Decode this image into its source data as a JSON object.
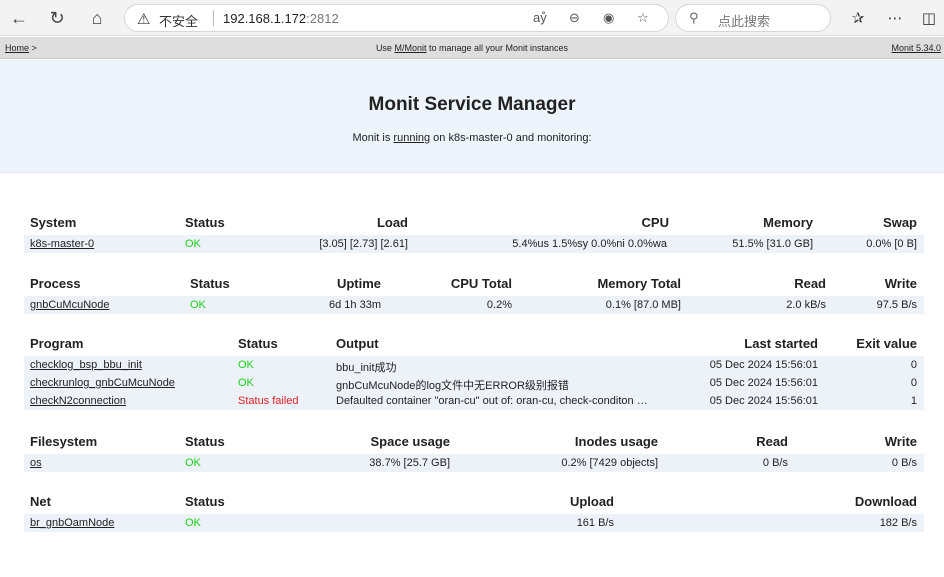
{
  "browser": {
    "insecure_label": "不安全",
    "url_host": "192.168.1.172",
    "url_port": ":2812",
    "search_placeholder": "点此搜索"
  },
  "nav": {
    "home": "Home",
    "home_sep": " >",
    "mid_prefix": "Use ",
    "mid_link": "M/Monit",
    "mid_suffix": " to manage all your Monit instances",
    "version": "Monit 5.34.0"
  },
  "header": {
    "title": "Monit Service Manager",
    "sub_prefix": "Monit is ",
    "sub_link": "running",
    "sub_suffix": " on k8s-master-0 and monitoring:"
  },
  "system": {
    "headers": {
      "name": "System",
      "status": "Status",
      "load": "Load",
      "cpu": "CPU",
      "memory": "Memory",
      "swap": "Swap"
    },
    "row": {
      "name": "k8s-master-0",
      "status": "OK",
      "load": "[3.05] [2.73] [2.61]",
      "cpu": "5.4%us 1.5%sy 0.0%ni 0.0%wa",
      "memory": "51.5% [31.0 GB]",
      "swap": "0.0% [0 B]"
    }
  },
  "process": {
    "headers": {
      "name": "Process",
      "status": "Status",
      "uptime": "Uptime",
      "cpu": "CPU Total",
      "memory": "Memory Total",
      "read": "Read",
      "write": "Write"
    },
    "row": {
      "name": "gnbCuMcuNode",
      "status": "OK",
      "uptime": "6d 1h 33m",
      "cpu": "0.2%",
      "memory": "0.1% [87.0 MB]",
      "read": "2.0 kB/s",
      "write": "97.5 B/s"
    }
  },
  "program": {
    "headers": {
      "name": "Program",
      "status": "Status",
      "output": "Output",
      "last": "Last started",
      "exit": "Exit value"
    },
    "rows": [
      {
        "name": "checklog_bsp_bbu_init",
        "status": "OK",
        "output": "bbu_init成功",
        "last": "05 Dec 2024 15:56:01",
        "exit": "0"
      },
      {
        "name": "checkrunlog_gnbCuMcuNode",
        "status": "OK",
        "output": "gnbCuMcuNode的log文件中无ERROR级别报错",
        "last": "05 Dec 2024 15:56:01",
        "exit": "0"
      },
      {
        "name": "checkN2connection",
        "status": "Status failed",
        "output": "Defaulted container \"oran-cu\" out of: oran-cu, check-conditon …",
        "last": "05 Dec 2024 15:56:01",
        "exit": "1"
      }
    ]
  },
  "filesystem": {
    "headers": {
      "name": "Filesystem",
      "status": "Status",
      "space": "Space usage",
      "inodes": "Inodes usage",
      "read": "Read",
      "write": "Write"
    },
    "row": {
      "name": "os",
      "status": "OK",
      "space": "38.7% [25.7 GB]",
      "inodes": "0.2% [7429 objects]",
      "read": "0 B/s",
      "write": "0 B/s"
    }
  },
  "net": {
    "headers": {
      "name": "Net",
      "status": "Status",
      "upload": "Upload",
      "download": "Download"
    },
    "row": {
      "name": "br_gnbOamNode",
      "status": "OK",
      "upload": "161 B/s",
      "download": "182 B/s"
    }
  }
}
